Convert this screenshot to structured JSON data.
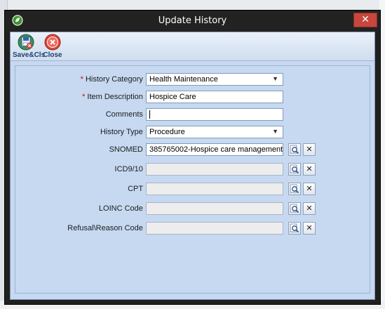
{
  "window": {
    "title": "Update History"
  },
  "toolbar": {
    "save_label": "Save&Cls",
    "close_label": "Close"
  },
  "form": {
    "history_category": {
      "label": "History Category :",
      "required_mark": "*",
      "value": "Health Maintenance"
    },
    "item_description": {
      "label": "Item Description :",
      "required_mark": "*",
      "value": "Hospice Care"
    },
    "comments": {
      "label": "Comments :",
      "value": ""
    },
    "history_type": {
      "label": "History Type :",
      "value": "Procedure"
    },
    "snomed": {
      "label": "SNOMED :",
      "value": "385765002-Hospice care management"
    },
    "icd": {
      "label": "ICD9/10 :",
      "value": ""
    },
    "cpt": {
      "label": "CPT :",
      "value": ""
    },
    "loinc": {
      "label": "LOINC Code :",
      "value": ""
    },
    "refusal": {
      "label": "Refusal\\Reason Code :",
      "value": ""
    }
  },
  "icons": {
    "app": "app-leaf-icon",
    "save": "save-close-icon",
    "close": "close-circle-icon",
    "lookup": "magnifier-icon",
    "clear": "clear-x-icon"
  },
  "colors": {
    "client_bg": "#c6d9f1",
    "required": "#d60000",
    "close_button": "#c7463d"
  }
}
